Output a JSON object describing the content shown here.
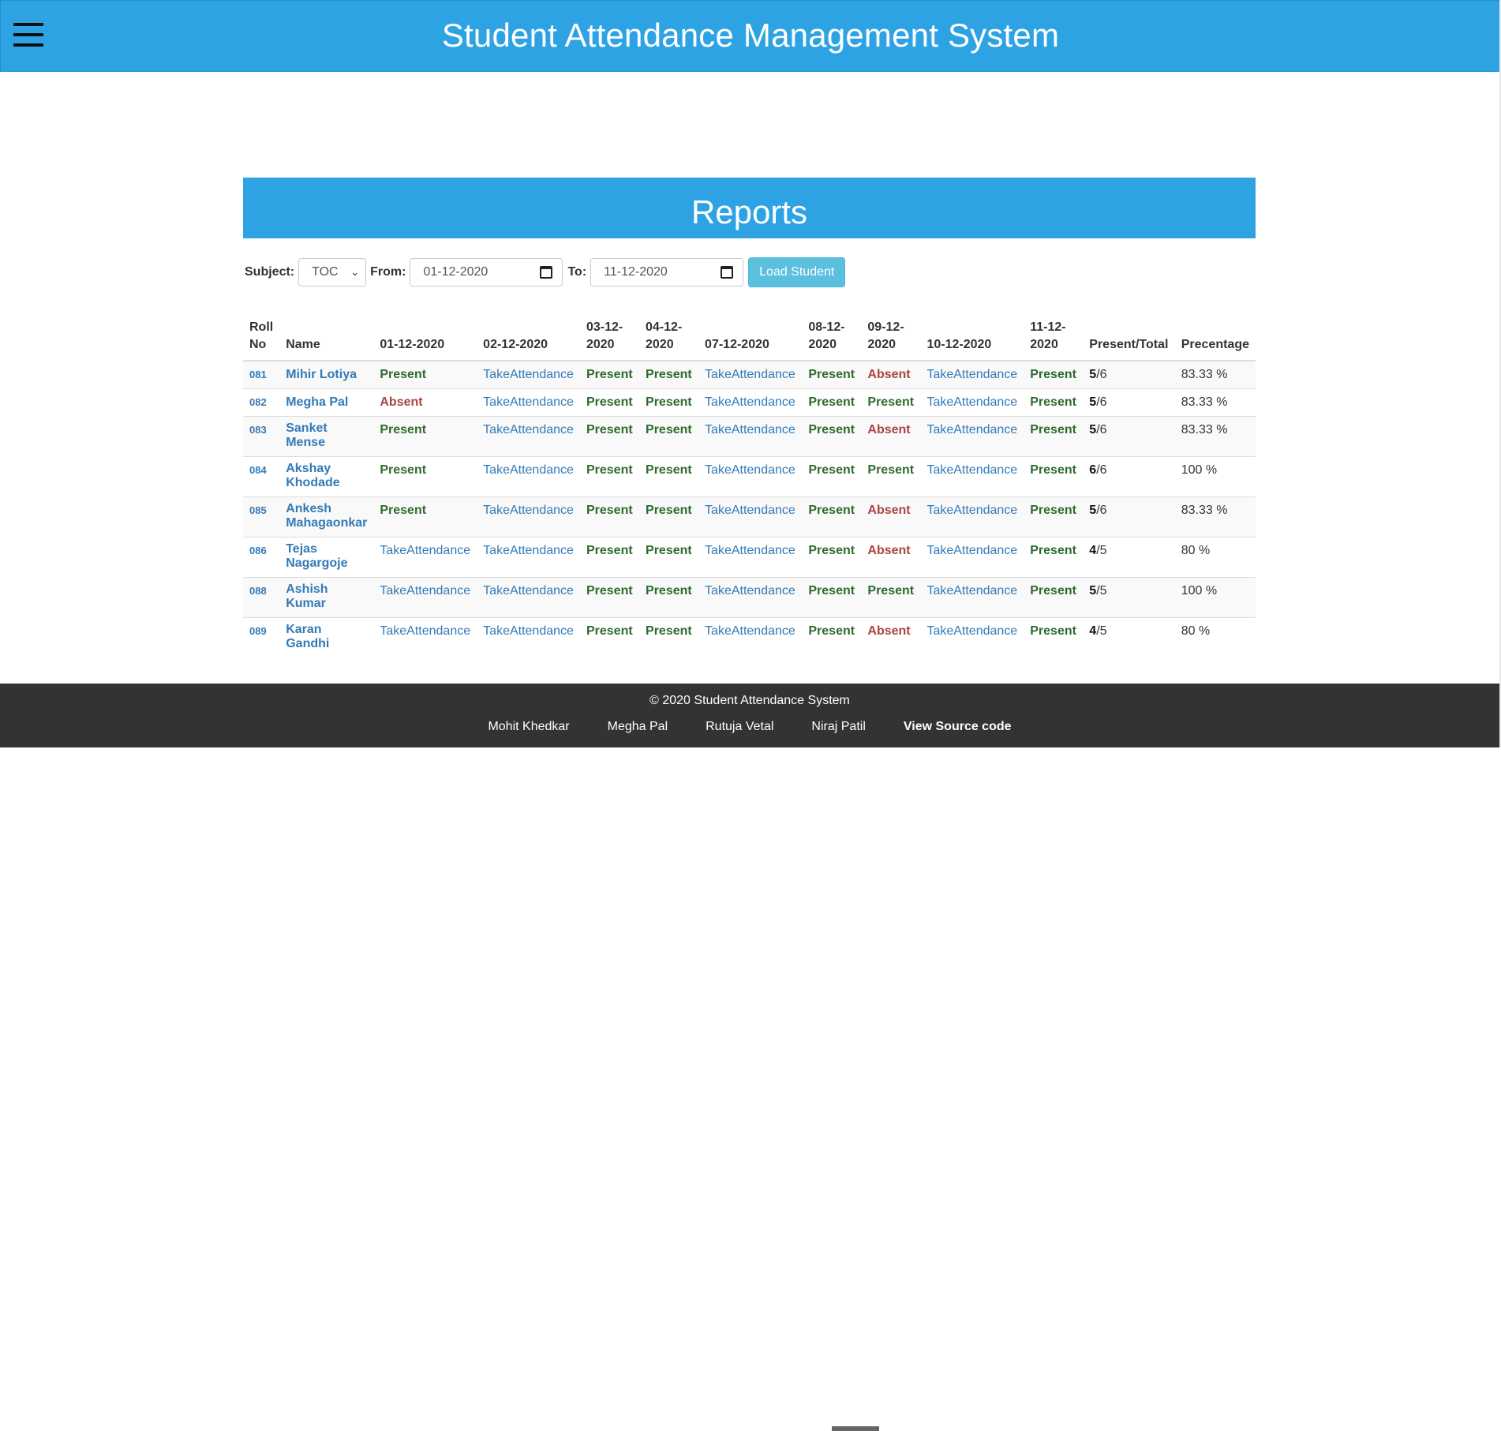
{
  "header": {
    "title": "Student Attendance Management System",
    "menu_icon": "hamburger-menu-icon"
  },
  "reports": {
    "title": "Reports"
  },
  "filters": {
    "subject_label": "Subject:",
    "subject_value": "TOC",
    "from_label": "From:",
    "from_value": "01-12-2020",
    "to_label": "To:",
    "to_value": "11-12-2020",
    "load_button": "Load Student"
  },
  "table": {
    "headers": [
      "Roll No",
      "Name",
      "01-12-2020",
      "02-12-2020",
      "03-12-2020",
      "04-12-2020",
      "07-12-2020",
      "08-12-2020",
      "09-12-2020",
      "10-12-2020",
      "11-12-2020",
      "Present/Total",
      "Precentage"
    ],
    "rows": [
      {
        "roll": "081",
        "name": "Mihir Lotiya",
        "att": [
          "Present",
          "TakeAttendance",
          "Present",
          "Present",
          "TakeAttendance",
          "Present",
          "Absent",
          "TakeAttendance",
          "Present"
        ],
        "present": "5",
        "total": "/6",
        "pct": "83.33 %"
      },
      {
        "roll": "082",
        "name": "Megha Pal",
        "att": [
          "Absent",
          "TakeAttendance",
          "Present",
          "Present",
          "TakeAttendance",
          "Present",
          "Present",
          "TakeAttendance",
          "Present"
        ],
        "present": "5",
        "total": "/6",
        "pct": "83.33 %"
      },
      {
        "roll": "083",
        "name": "Sanket Mense",
        "att": [
          "Present",
          "TakeAttendance",
          "Present",
          "Present",
          "TakeAttendance",
          "Present",
          "Absent",
          "TakeAttendance",
          "Present"
        ],
        "present": "5",
        "total": "/6",
        "pct": "83.33 %"
      },
      {
        "roll": "084",
        "name": "Akshay Khodade",
        "att": [
          "Present",
          "TakeAttendance",
          "Present",
          "Present",
          "TakeAttendance",
          "Present",
          "Present",
          "TakeAttendance",
          "Present"
        ],
        "present": "6",
        "total": "/6",
        "pct": "100 %"
      },
      {
        "roll": "085",
        "name": "Ankesh Mahagaonkar",
        "att": [
          "Present",
          "TakeAttendance",
          "Present",
          "Present",
          "TakeAttendance",
          "Present",
          "Absent",
          "TakeAttendance",
          "Present"
        ],
        "present": "5",
        "total": "/6",
        "pct": "83.33 %"
      },
      {
        "roll": "086",
        "name": "Tejas Nagargoje",
        "att": [
          "TakeAttendance",
          "TakeAttendance",
          "Present",
          "Present",
          "TakeAttendance",
          "Present",
          "Absent",
          "TakeAttendance",
          "Present"
        ],
        "present": "4",
        "total": "/5",
        "pct": "80 %"
      },
      {
        "roll": "088",
        "name": "Ashish Kumar",
        "att": [
          "TakeAttendance",
          "TakeAttendance",
          "Present",
          "Present",
          "TakeAttendance",
          "Present",
          "Present",
          "TakeAttendance",
          "Present"
        ],
        "present": "5",
        "total": "/5",
        "pct": "100 %"
      },
      {
        "roll": "089",
        "name": "Karan Gandhi",
        "att": [
          "TakeAttendance",
          "TakeAttendance",
          "Present",
          "Present",
          "TakeAttendance",
          "Present",
          "Absent",
          "TakeAttendance",
          "Present"
        ],
        "present": "4",
        "total": "/5",
        "pct": "80 %"
      }
    ]
  },
  "footer": {
    "copyright": "© 2020 Student Attendance System",
    "credits": [
      "Mohit Khedkar",
      "Megha Pal",
      "Rutuja Vetal",
      "Niraj Patil"
    ],
    "source_link": "View Source code"
  },
  "colors": {
    "primary": "#2ea3e3",
    "present": "#2e6b2e",
    "absent": "#a94442",
    "link": "#337ab7",
    "footer": "#333333",
    "button": "#5bc0de"
  }
}
